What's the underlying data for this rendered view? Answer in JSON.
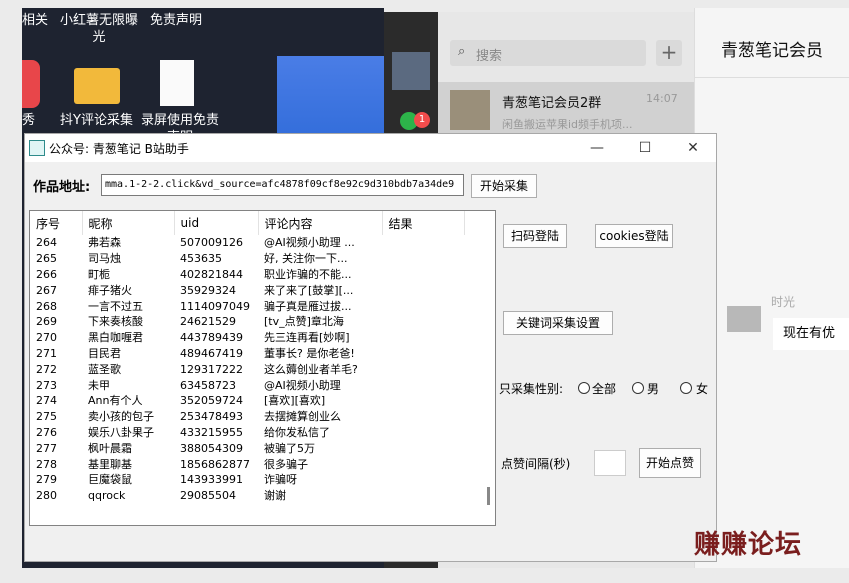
{
  "desktop": {
    "labels": [
      "相关",
      "小红薯无限曝光",
      "免责声明"
    ],
    "icons": [
      "秀",
      "抖Y评论采集",
      "录屏使用免责声明"
    ]
  },
  "chat": {
    "badge": "1",
    "search_placeholder": "搜索",
    "plus": "+",
    "title": "青葱笔记会员",
    "item": {
      "name": "青葱笔记会员2群",
      "time": "14:07",
      "preview": "闲鱼搬运苹果id频手机项..."
    },
    "sender": "时光",
    "message": "现在有优"
  },
  "window": {
    "title": "公众号: 青葱笔记 B站助手",
    "min": "—",
    "max": "☐",
    "close": "✕"
  },
  "form": {
    "url_label": "作品地址:",
    "url_value": "mma.1-2-2.click&vd_source=afc4878f09cf8e92c9d310bdb7a34de9",
    "start_button": "开始采集"
  },
  "table": {
    "headers": [
      "序号",
      "昵称",
      "uid",
      "评论内容",
      "结果"
    ],
    "rows": [
      [
        "264",
        "弗若森",
        "507009126",
        "@AI视频小助理 ...",
        ""
      ],
      [
        "265",
        "司马烛",
        "453635",
        "好, 关注你一下...",
        ""
      ],
      [
        "266",
        "町栀",
        "402821844",
        "职业诈骗的不能...",
        ""
      ],
      [
        "267",
        "痱子猪火",
        "35929324",
        "来了来了[鼓掌][...",
        ""
      ],
      [
        "268",
        "一言不过五",
        "1114097049",
        "骗子真是雁过拔...",
        ""
      ],
      [
        "269",
        "下来奏核酸",
        "24621529",
        "[tv_点赞]章北海",
        ""
      ],
      [
        "270",
        "黑白咖喱君",
        "443789439",
        "先三连再看[妙啊]",
        ""
      ],
      [
        "271",
        "目民君",
        "489467419",
        "董事长? 是你老爸!",
        ""
      ],
      [
        "272",
        "蓝圣歌",
        "129317222",
        "这么薅创业者羊毛?",
        ""
      ],
      [
        "273",
        "未甲",
        "63458723",
        "@AI视频小助理",
        ""
      ],
      [
        "274",
        "Ann有个人",
        "352059724",
        "[喜欢][喜欢]",
        ""
      ],
      [
        "275",
        "卖小孩的包子",
        "253478493",
        "去摆摊算创业么",
        ""
      ],
      [
        "276",
        "娱乐八卦果子",
        "433215955",
        "给你发私信了",
        ""
      ],
      [
        "277",
        "枫叶晨霜",
        "388054309",
        "被骗了5万",
        ""
      ],
      [
        "278",
        "基里聊基",
        "1856862877",
        "很多骗子",
        ""
      ],
      [
        "279",
        "巨魔袋鼠",
        "143933991",
        "诈骗呀",
        ""
      ],
      [
        "280",
        "qqrock",
        "29085504",
        "谢谢",
        ""
      ]
    ]
  },
  "buttons": {
    "qr_login": "扫码登陆",
    "cookies_login": "cookies登陆",
    "keyword_settings": "关键词采集设置"
  },
  "gender": {
    "label": "只采集性别:",
    "options": [
      "全部",
      "男",
      "女"
    ]
  },
  "like": {
    "interval_label": "点赞间隔(秒)",
    "start_button": "开始点赞"
  },
  "watermark": "赚赚论坛"
}
